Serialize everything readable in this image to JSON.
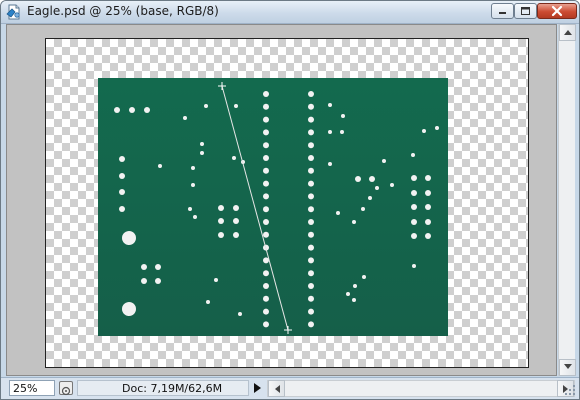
{
  "window": {
    "title": "Eagle.psd @ 25% (base, RGB/8)",
    "controls": [
      "minimize",
      "maximize",
      "close"
    ]
  },
  "status": {
    "zoom": "25%",
    "doc_info": "Doc: 7,19M/62,6M"
  },
  "colors": {
    "board_green": "#136a4e",
    "hole_white": "#f2f2f2",
    "workspace_gray": "#c2c2c2",
    "titlebar_blue": "#cddbea"
  },
  "icons": [
    "photoshop-file-icon",
    "minimize-icon",
    "maximize-icon",
    "close-icon",
    "scroll-up-icon",
    "scroll-down-icon",
    "scroll-left-icon",
    "scroll-right-icon",
    "zoom-options-icon",
    "status-menu-arrow-icon",
    "resize-grip-icon"
  ]
}
